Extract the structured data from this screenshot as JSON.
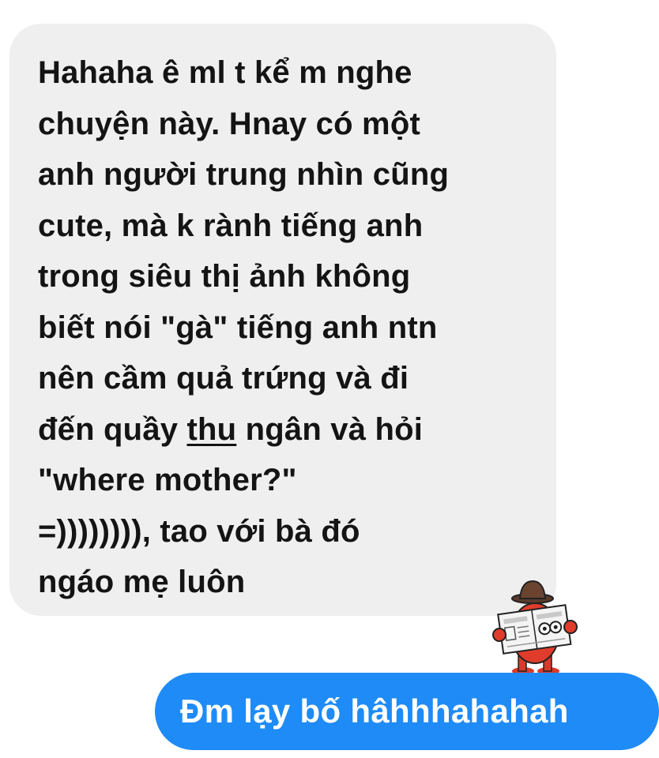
{
  "colors": {
    "received_bubble": "#efefef",
    "received_text": "#141414",
    "sent_bubble": "#1f8bf6",
    "sent_text": "#ffffff"
  },
  "received_message": {
    "lines": [
      "Hahaha ê ml t kể m nghe",
      "chuyện này. Hnay có một",
      "anh người trung nhìn cũng",
      "cute, mà k rành tiếng anh",
      "trong siêu thị ảnh không",
      "biết nói \"gà\" tiếng anh ntn",
      "nên cầm quả trứng và đi",
      "\"where mother?\"",
      "=)))))))), tao với bà đó",
      "ngáo mẹ luôn"
    ],
    "line_9": {
      "before": "đến quầy ",
      "underlined": "thu",
      "after": " ngân và hỏi"
    }
  },
  "sticker": {
    "icon": "newspaper-reader-sticker-icon"
  },
  "sent_message": {
    "text": "Đm lạy bố hâhhhahahah"
  }
}
